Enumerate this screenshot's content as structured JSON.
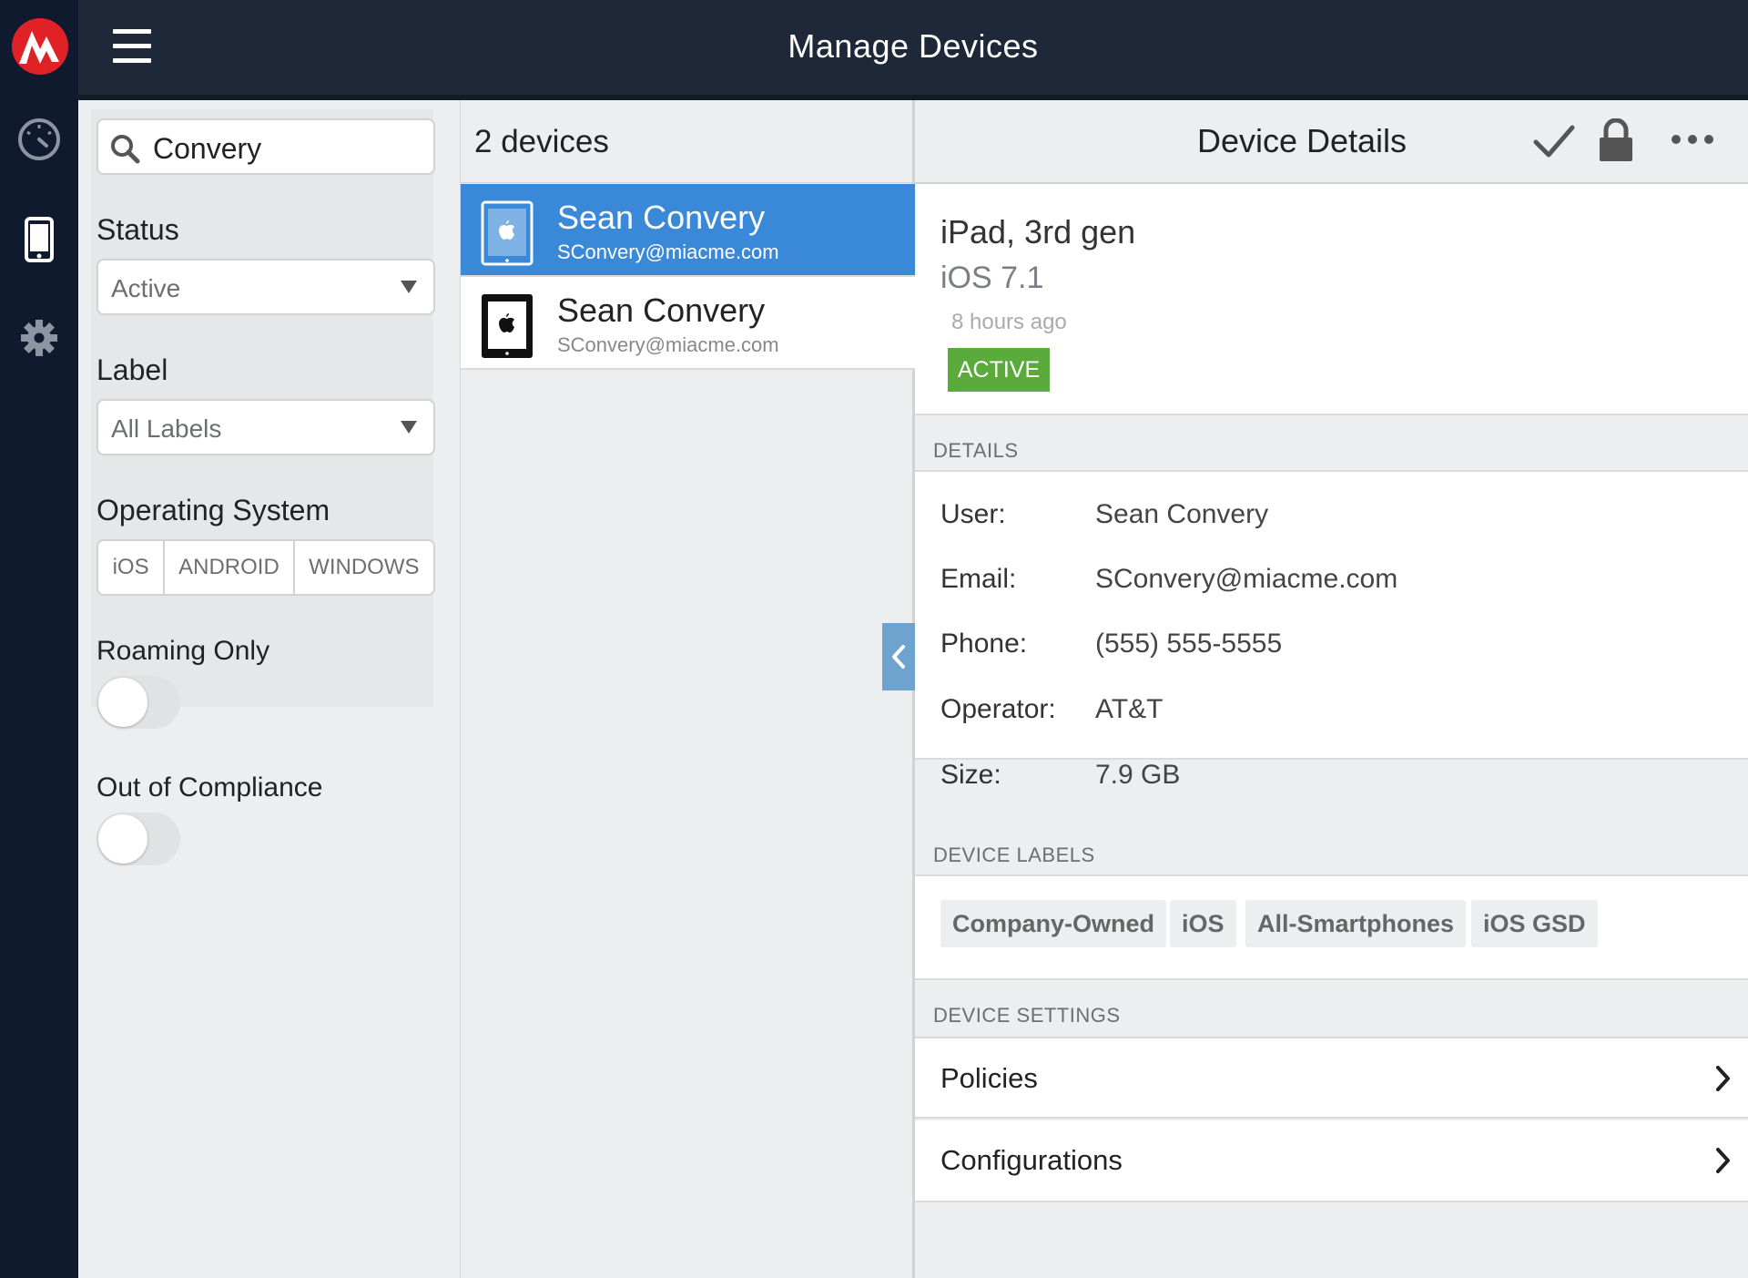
{
  "app": {
    "title": "Manage Devices",
    "brand_color": "#e02227"
  },
  "nav": {
    "items": [
      {
        "icon": "dashboard-icon"
      },
      {
        "icon": "device-icon"
      },
      {
        "icon": "gear-icon"
      }
    ]
  },
  "filters": {
    "search": {
      "value": "Convery",
      "icon": "search-icon"
    },
    "status": {
      "label": "Status",
      "value": "Active"
    },
    "label": {
      "label": "Label",
      "value": "All Labels"
    },
    "os": {
      "label": "Operating System",
      "options": [
        "iOS",
        "ANDROID",
        "WINDOWS"
      ]
    },
    "roaming": {
      "label": "Roaming Only",
      "on": false
    },
    "compliance": {
      "label": "Out of Compliance",
      "on": false
    }
  },
  "devices": {
    "count_text": "2 devices",
    "items": [
      {
        "name": "Sean Convery",
        "email": "SConvery@miacme.com",
        "selected": true
      },
      {
        "name": "Sean Convery",
        "email": "SConvery@miacme.com",
        "selected": false
      }
    ]
  },
  "details": {
    "title": "Device Details",
    "actions": [
      "check-icon",
      "lock-icon",
      "more-icon"
    ],
    "model": "iPad, 3rd gen",
    "os": "iOS 7.1",
    "last_seen": "8 hours ago",
    "status_badge": "ACTIVE",
    "status_color": "#5aaa3c",
    "details_header": "DETAILS",
    "fields": [
      {
        "key": "User:",
        "value": "Sean Convery"
      },
      {
        "key": "Email:",
        "value": "SConvery@miacme.com"
      },
      {
        "key": "Phone:",
        "value": "(555) 555-5555"
      },
      {
        "key": "Operator:",
        "value": "AT&T"
      },
      {
        "key": "Size:",
        "value": "7.9 GB"
      }
    ],
    "labels_header": "DEVICE LABELS",
    "labels": [
      "Company-Owned",
      "iOS",
      "All-Smartphones",
      "iOS GSD"
    ],
    "settings_header": "DEVICE SETTINGS",
    "settings": [
      {
        "label": "Policies"
      },
      {
        "label": "Configurations"
      }
    ]
  }
}
